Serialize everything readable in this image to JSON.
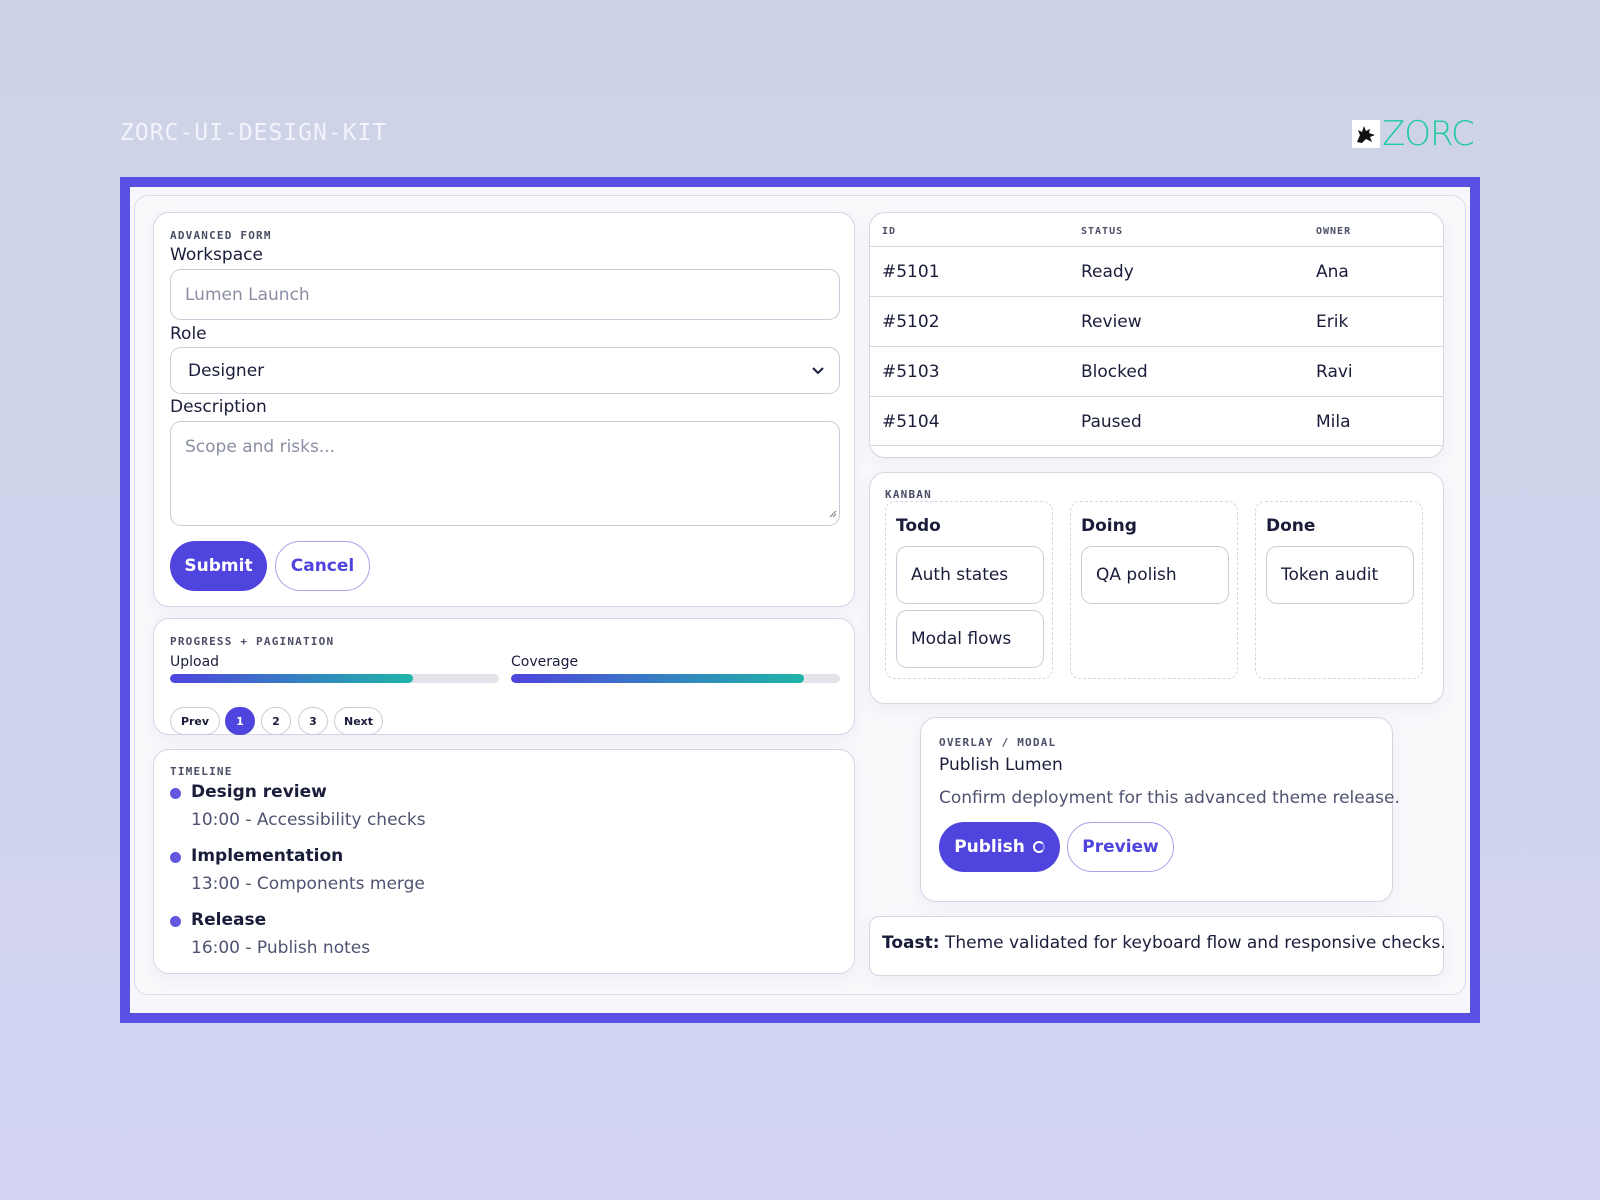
{
  "header": {
    "kit_title": "ZORC-UI-DESIGN-KIT",
    "logo_text": "ZORC"
  },
  "colors": {
    "accent": "#4f44de",
    "frame": "#5b50e4",
    "logo": "#22c9a0",
    "teal": "#1fb5a8"
  },
  "form": {
    "eyebrow": "ADVANCED FORM",
    "workspace_label": "Workspace",
    "workspace_placeholder": "Lumen Launch",
    "role_label": "Role",
    "role_value": "Designer",
    "description_label": "Description",
    "description_placeholder": "Scope and risks...",
    "submit_label": "Submit",
    "cancel_label": "Cancel"
  },
  "progress": {
    "eyebrow": "PROGRESS + PAGINATION",
    "upload_label": "Upload",
    "upload_value": 0.74,
    "coverage_label": "Coverage",
    "coverage_value": 0.89,
    "pagination": {
      "prev": "Prev",
      "pages": [
        "1",
        "2",
        "3"
      ],
      "next": "Next",
      "current": "1"
    }
  },
  "timeline": {
    "eyebrow": "TIMELINE",
    "items": [
      {
        "title": "Design review",
        "detail": "10:00 - Accessibility checks"
      },
      {
        "title": "Implementation",
        "detail": "13:00 - Components merge"
      },
      {
        "title": "Release",
        "detail": "16:00 - Publish notes"
      }
    ]
  },
  "table": {
    "headers": [
      "ID",
      "STATUS",
      "OWNER"
    ],
    "rows": [
      [
        "#5101",
        "Ready",
        "Ana"
      ],
      [
        "#5102",
        "Review",
        "Erik"
      ],
      [
        "#5103",
        "Blocked",
        "Ravi"
      ],
      [
        "#5104",
        "Paused",
        "Mila"
      ]
    ]
  },
  "kanban": {
    "eyebrow": "KANBAN",
    "columns": [
      {
        "title": "Todo",
        "cards": [
          "Auth states",
          "Modal flows"
        ]
      },
      {
        "title": "Doing",
        "cards": [
          "QA polish"
        ]
      },
      {
        "title": "Done",
        "cards": [
          "Token audit"
        ]
      }
    ]
  },
  "modal": {
    "eyebrow": "OVERLAY / MODAL",
    "title": "Publish Lumen",
    "body": "Confirm deployment for this advanced theme release.",
    "publish_label": "Publish",
    "preview_label": "Preview"
  },
  "toast": {
    "label": "Toast:",
    "message": "Theme validated for keyboard flow and responsive checks."
  }
}
